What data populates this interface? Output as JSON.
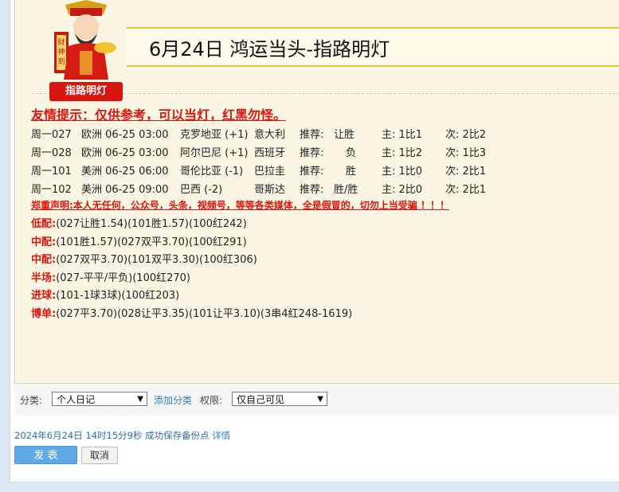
{
  "post": {
    "title": "6月24日 鸿运当头-指路明灯",
    "badge": "指路明灯",
    "mascot_scroll": "财神到",
    "tip": "友情提示：仅供参考，可以当灯，红黑勿怪。",
    "matches": [
      {
        "id": "周一027",
        "league": "欧洲",
        "time": "06-25 03:00",
        "home": "克罗地亚 (+1)",
        "away": "意大利",
        "rec_label": "推荐:",
        "rec": "让胜",
        "main_label": "主:",
        "main": "1比1",
        "alt_label": "次:",
        "alt": "2比2"
      },
      {
        "id": "周一028",
        "league": "欧洲",
        "time": "06-25 03:00",
        "home": "阿尔巴尼 (+1)",
        "away": "西班牙",
        "rec_label": "推荐:",
        "rec": "负",
        "main_label": "主:",
        "main": "1比2",
        "alt_label": "次:",
        "alt": "1比3"
      },
      {
        "id": "周一101",
        "league": "美洲",
        "time": "06-25 06:00",
        "home": "哥伦比亚 (-1)",
        "away": "巴拉圭",
        "rec_label": "推荐:",
        "rec": "胜",
        "main_label": "主:",
        "main": "1比0",
        "alt_label": "次:",
        "alt": "2比1"
      },
      {
        "id": "周一102",
        "league": "美洲",
        "time": "06-25 09:00",
        "home": "巴西 (-2)",
        "away": "哥斯达",
        "rec_label": "推荐:",
        "rec": "胜/胜",
        "main_label": "主:",
        "main": "2比0",
        "alt_label": "次:",
        "alt": "2比1"
      }
    ],
    "disclaimer": "郑重声明:本人无任何，公众号，头条，视频号，等等各类媒体，全是假冒的，切勿上当受骗 ！！！",
    "picks": [
      {
        "label": "低配:",
        "value": "(027让胜1.54)(101胜1.57)(100红242)"
      },
      {
        "label": "中配:",
        "value": "(101胜1.57)(027双平3.70)(100红291)"
      },
      {
        "label": "中配:",
        "value": "(027双平3.70)(101双平3.30)(100红306)"
      },
      {
        "label": "半场:",
        "value": "(027-平平/平负)(100红270)"
      },
      {
        "label": "进球:",
        "value": "(101-1球3球)(100红203)"
      },
      {
        "label": "博单:",
        "value": "(027平3.70)(028让平3.35)(101让平3.10)(3串4红248-1619)"
      }
    ]
  },
  "toolbar": {
    "category_label": "分类:",
    "category_value": "个人日记",
    "add_category": "添加分类",
    "permission_label": "权限:",
    "permission_value": "仅自己可见"
  },
  "status": {
    "saved_text": "2024年6月24日 14时15分9秒 成功保存备份点",
    "detail_link": "详情"
  },
  "buttons": {
    "publish": "发 表",
    "cancel": "取消"
  },
  "colors": {
    "accent_red": "#e0130c",
    "title_border": "#f4c63a",
    "link_blue": "#2f7fc1",
    "publish_button": "#5fa9e6"
  },
  "icons": [
    "god-of-wealth-mascot-icon",
    "dropdown-arrow-icon"
  ]
}
